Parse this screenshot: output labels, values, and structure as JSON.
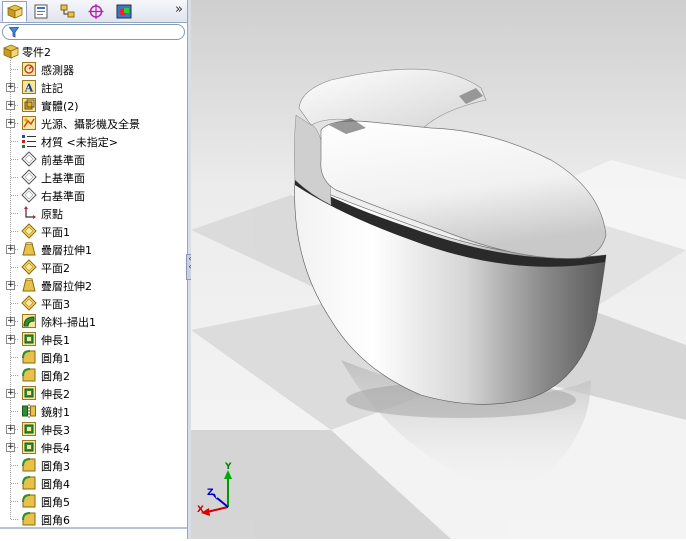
{
  "feature_manager": {
    "tabs": [
      {
        "icon": "feature-manager-icon"
      },
      {
        "icon": "property-manager-icon"
      },
      {
        "icon": "configuration-manager-icon"
      },
      {
        "icon": "dimxpert-manager-icon"
      },
      {
        "icon": "display-manager-icon"
      }
    ],
    "more_label": "»",
    "filter_icon": "filter-icon",
    "root": {
      "label": "零件2",
      "icon": "part-icon"
    },
    "items": [
      {
        "label": "感測器",
        "icon": "sensor-icon",
        "expandable": false
      },
      {
        "label": "註記",
        "icon": "annotation-icon",
        "expandable": true
      },
      {
        "label": "實體(2)",
        "icon": "solid-bodies-icon",
        "expandable": true
      },
      {
        "label": "光源、攝影機及全景",
        "icon": "lights-camera-icon",
        "expandable": true
      },
      {
        "label": "材質 <未指定>",
        "icon": "material-icon",
        "expandable": false
      },
      {
        "label": "前基準面",
        "icon": "plane-icon",
        "expandable": false
      },
      {
        "label": "上基準面",
        "icon": "plane-icon",
        "expandable": false
      },
      {
        "label": "右基準面",
        "icon": "plane-icon",
        "expandable": false
      },
      {
        "label": "原點",
        "icon": "origin-icon",
        "expandable": false
      },
      {
        "label": "平面1",
        "icon": "ref-plane-icon",
        "expandable": false
      },
      {
        "label": "疊層拉伸1",
        "icon": "loft-icon",
        "expandable": true
      },
      {
        "label": "平面2",
        "icon": "ref-plane-icon",
        "expandable": false
      },
      {
        "label": "疊層拉伸2",
        "icon": "loft-icon",
        "expandable": true
      },
      {
        "label": "平面3",
        "icon": "ref-plane-icon",
        "expandable": false
      },
      {
        "label": "除料-掃出1",
        "icon": "swept-cut-icon",
        "expandable": true
      },
      {
        "label": "伸長1",
        "icon": "extrude-icon",
        "expandable": true
      },
      {
        "label": "圓角1",
        "icon": "fillet-icon",
        "expandable": false
      },
      {
        "label": "圓角2",
        "icon": "fillet-icon",
        "expandable": false
      },
      {
        "label": "伸長2",
        "icon": "extrude-icon",
        "expandable": true
      },
      {
        "label": "鏡射1",
        "icon": "mirror-icon",
        "expandable": false
      },
      {
        "label": "伸長3",
        "icon": "extrude-icon",
        "expandable": true
      },
      {
        "label": "伸長4",
        "icon": "extrude-icon",
        "expandable": true
      },
      {
        "label": "圓角3",
        "icon": "fillet-icon",
        "expandable": false
      },
      {
        "label": "圓角4",
        "icon": "fillet-icon",
        "expandable": false
      },
      {
        "label": "圓角5",
        "icon": "fillet-icon",
        "expandable": false
      },
      {
        "label": "圓角6",
        "icon": "fillet-icon",
        "expandable": false
      }
    ]
  },
  "viewport": {
    "triad": {
      "x": "X",
      "y": "Y",
      "z": "Z"
    },
    "model": "toilet-model",
    "colors": {
      "floor_light": "#f4f4f4",
      "floor_dark": "#d9d9d9",
      "x_axis": "#cc0000",
      "y_axis": "#009900",
      "z_axis": "#0000cc"
    }
  }
}
